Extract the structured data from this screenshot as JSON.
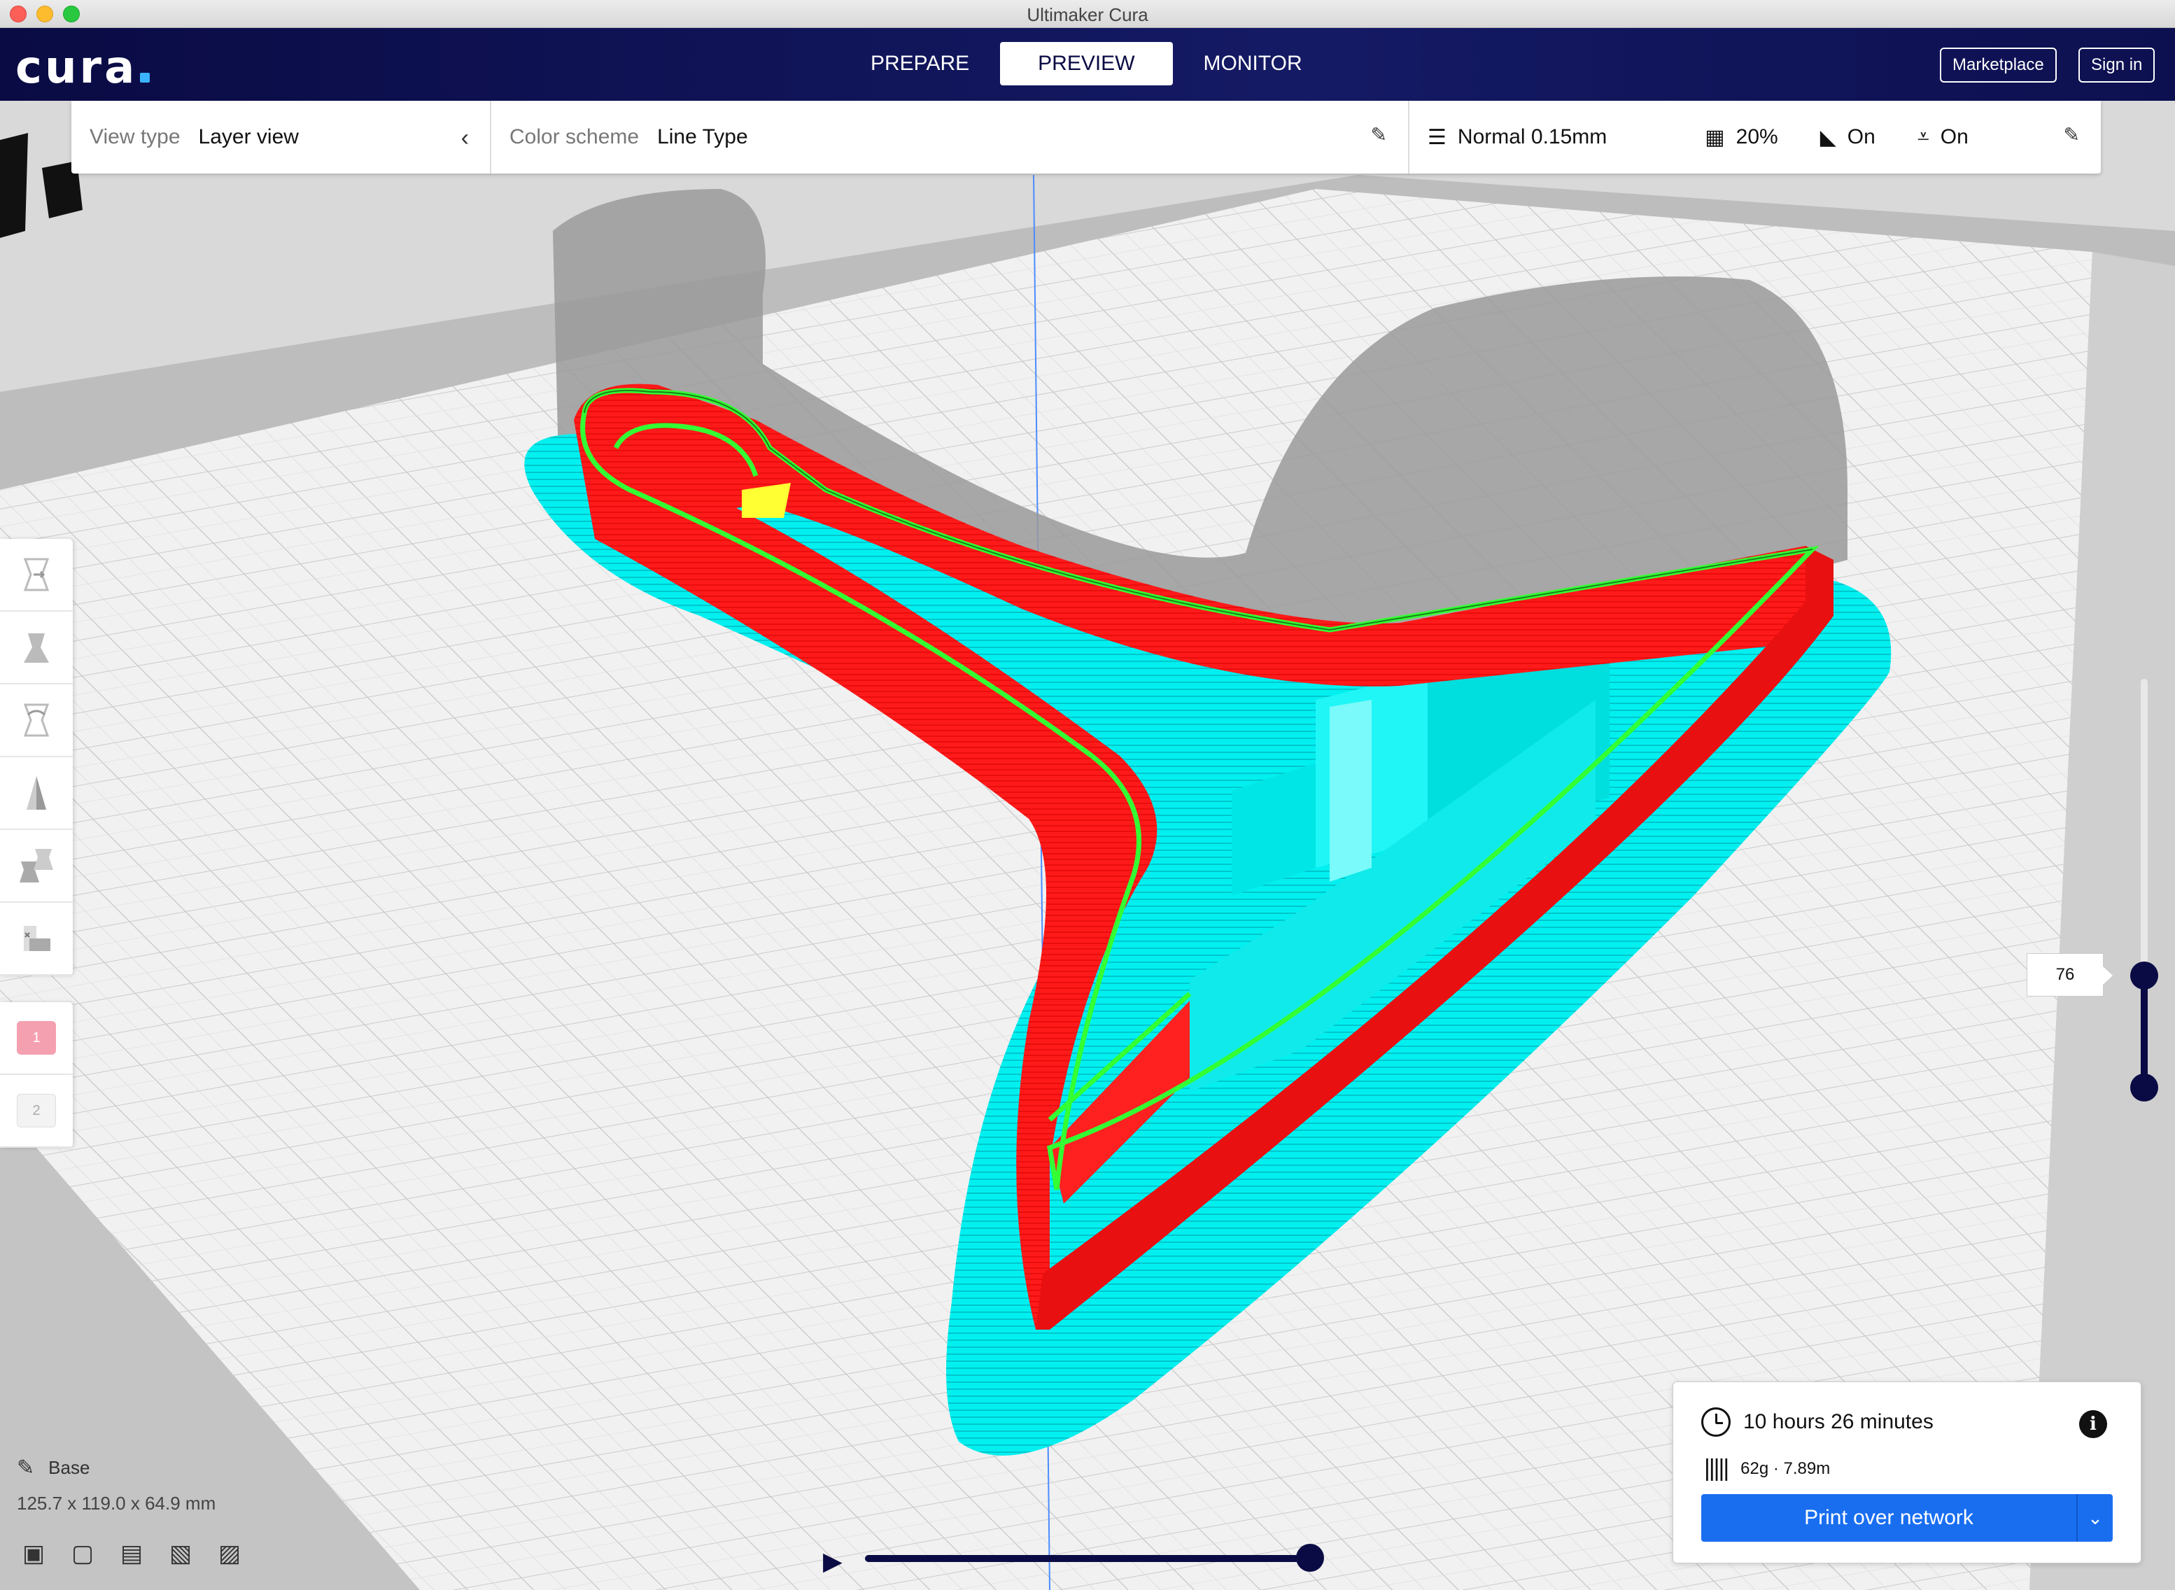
{
  "window": {
    "title": "Ultimaker Cura"
  },
  "header": {
    "logo": "cura",
    "tabs": [
      {
        "label": "PREPARE",
        "active": false
      },
      {
        "label": "PREVIEW",
        "active": true
      },
      {
        "label": "MONITOR",
        "active": false
      }
    ],
    "marketplace_label": "Marketplace",
    "signin_label": "Sign in"
  },
  "view_settings": {
    "view_type_label": "View type",
    "view_type_value": "Layer view",
    "color_scheme_label": "Color scheme",
    "color_scheme_value": "Line Type"
  },
  "print_settings": {
    "profile": "Normal 0.15mm",
    "infill": "20%",
    "support": "On",
    "adhesion": "On"
  },
  "layer_slider": {
    "current_layer": "76"
  },
  "extensions": [
    "1",
    "2"
  ],
  "object": {
    "name": "Base",
    "dimensions": "125.7 x 119.0 x 64.9 mm"
  },
  "summary": {
    "time": "10 hours 26 minutes",
    "material": "62g · 7.89m",
    "print_button": "Print over network"
  },
  "colors": {
    "header_bg": "#0a0b44",
    "print_button": "#196ef0",
    "wall_outer": "#ff1a1a",
    "wall_inner": "#33ff33",
    "support_skirt": "#00ffff",
    "infill": "#ffff00",
    "ghost_model": "#9a9a9a"
  },
  "icons": {
    "view_type_toggle": "chevron-left-icon",
    "color_scheme_edit": "pencil-icon",
    "profile": "layers-icon",
    "infill": "infill-icon",
    "support": "support-icon",
    "adhesion": "adhesion-icon",
    "print_settings_edit": "pencil-icon",
    "time": "clock-icon",
    "material": "spool-icon",
    "info": "info-icon"
  }
}
